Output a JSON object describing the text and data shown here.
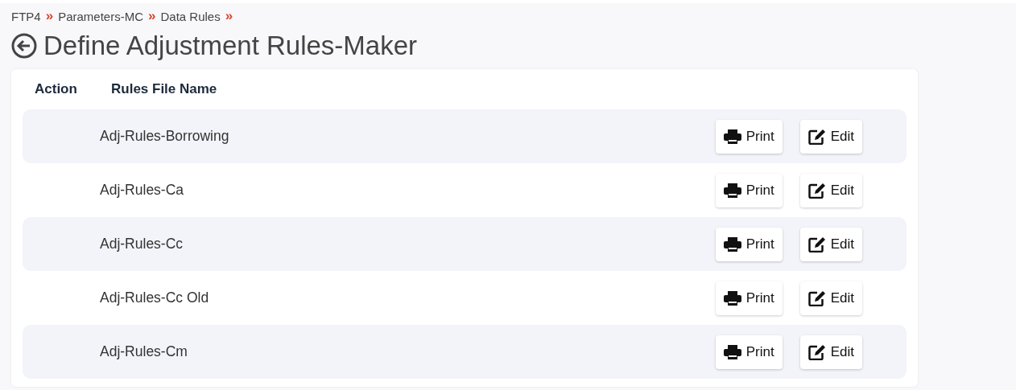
{
  "breadcrumb": [
    {
      "label": "FTP4",
      "separator": "»"
    },
    {
      "label": "Parameters-MC",
      "separator": "»"
    },
    {
      "label": "Data Rules",
      "separator": "»"
    }
  ],
  "page_title": "Define Adjustment Rules-Maker",
  "table": {
    "columns": [
      "Action",
      "Rules File Name"
    ],
    "rows": [
      {
        "name": "Adj-Rules-Borrowing",
        "buttons": [
          "Print",
          "Edit"
        ]
      },
      {
        "name": "Adj-Rules-Ca",
        "buttons": [
          "Print",
          "Edit"
        ]
      },
      {
        "name": "Adj-Rules-Cc",
        "buttons": [
          "Print",
          "Edit"
        ]
      },
      {
        "name": "Adj-Rules-Cc Old",
        "buttons": [
          "Print",
          "Edit"
        ]
      },
      {
        "name": "Adj-Rules-Cm",
        "buttons": [
          "Print",
          "Edit"
        ]
      }
    ]
  }
}
